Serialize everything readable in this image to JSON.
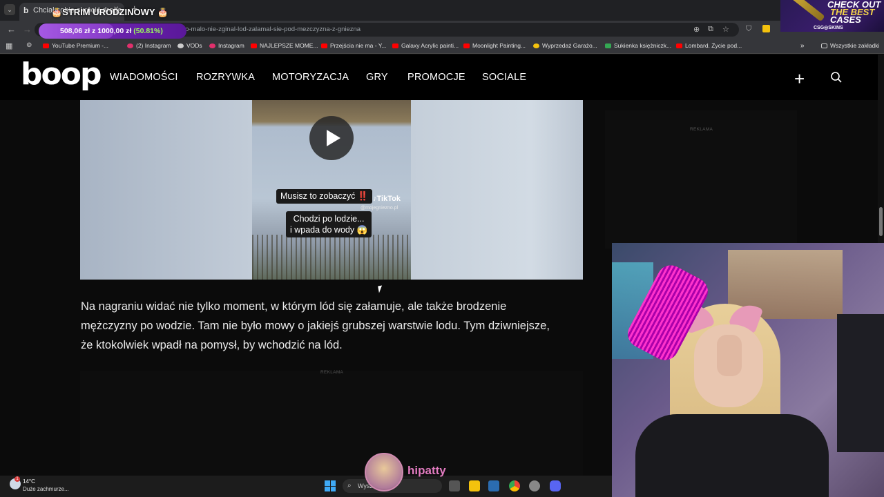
{
  "browser": {
    "tab_title": "Chciał sobie skrócić drogę",
    "tab_close": "✕",
    "new_tab": "+",
    "url": "...skrocic-droge-o-malo-nie-zginal-lod-zalamal-sie-pod-mezczyzna-z-gniezna",
    "bookmarks": [
      {
        "label": "YouTube Premium -...",
        "color": "#ff0000"
      },
      {
        "label": "(2) Instagram",
        "color": "#e1306c"
      },
      {
        "label": "VODs",
        "color": "#cccccc"
      },
      {
        "label": "Instagram",
        "color": "#e1306c"
      },
      {
        "label": "NAJLEPSZE MOME...",
        "color": "#ff0000"
      },
      {
        "label": "Przejścia nie ma - Y...",
        "color": "#ff0000"
      },
      {
        "label": "Galaxy Acrylic painti...",
        "color": "#ff0000"
      },
      {
        "label": "Moonlight Painting...",
        "color": "#ff0000"
      },
      {
        "label": "Wyprzedaż Garażo...",
        "color": "#f4c20d"
      },
      {
        "label": "Sukienka księżniczk...",
        "color": "#34a853"
      },
      {
        "label": "Lombard. Życie pod...",
        "color": "#ff0000"
      }
    ],
    "bookmarks_more": "»",
    "all_bookmarks": "Wszystkie zakładki"
  },
  "overlay": {
    "title": "🎂STRIM URODZINOWY 🎂",
    "goal_text": "508,06 zł z 1000,00 zł",
    "goal_pct": "(50.81%)",
    "goal_fraction": 0.5081,
    "ad_line1": "CHECK OUT",
    "ad_line2": "THE BEST",
    "ad_line3": "CASES",
    "ad_brand": "CSG◎SKINS"
  },
  "site": {
    "logo": "boop",
    "nav": [
      "WIADOMOŚCI",
      "ROZRYWKA",
      "MOTORYZACJA",
      "GRY",
      "PROMOCJE",
      "SOCIALE"
    ]
  },
  "video": {
    "caption1": "Musisz to zobaczyć ‼️",
    "tiktok": "♪TikTok",
    "handle": "@mojegniezno.pl",
    "caption2_line1": "Chodzi po lodzie...",
    "caption2_line2": "i wpada do wody 😱"
  },
  "article": {
    "paragraph": "Na nagraniu widać nie tylko moment, w którym lód się załamuje, ale także brodzenie mężczyzny po wodzie. Tam nie było mowy o jakiejś grubszej warstwie lodu. Tym dziwniejsze, że ktokolwiek wpadł na pomysł, by wchodzić na lód."
  },
  "ads": {
    "label_side": "REKLAMA",
    "label_bottom": "REKLAMA"
  },
  "taskbar": {
    "temp": "14°C",
    "weather": "Duże zachmurze...",
    "search": "Wysz",
    "badge": "1"
  },
  "stream": {
    "name": "hipatty"
  }
}
